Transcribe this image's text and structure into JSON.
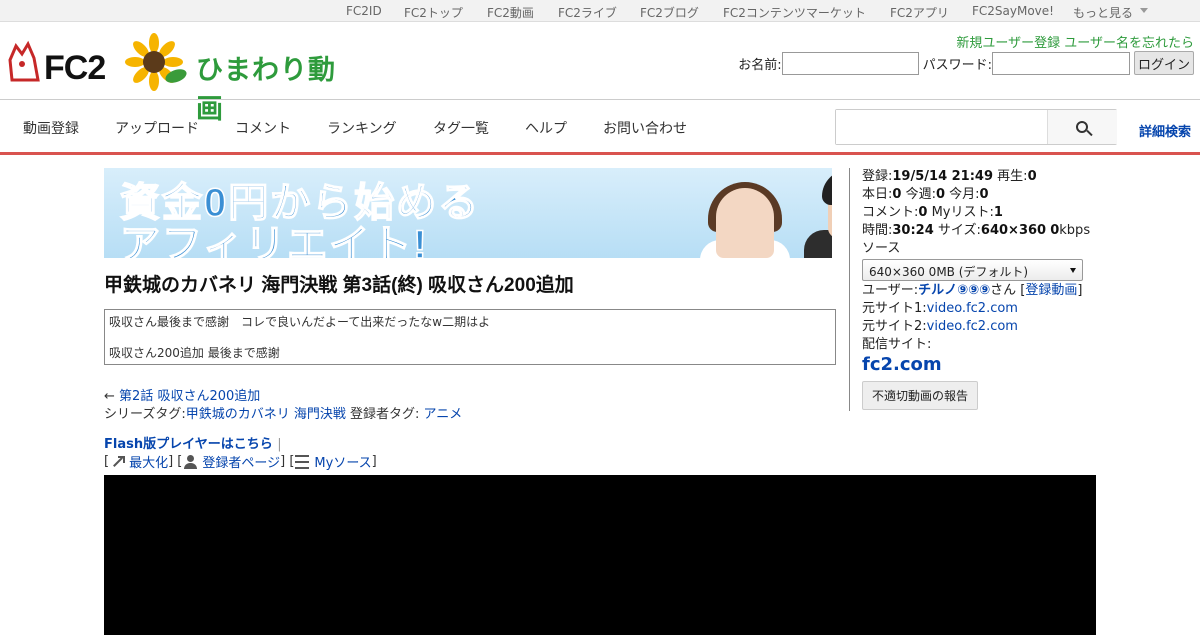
{
  "topbar": {
    "items": [
      "FC2ID",
      "FC2トップ",
      "FC2動画",
      "FC2ライブ",
      "FC2ブログ",
      "FC2コンテンツマーケット",
      "FC2アプリ",
      "FC2SayMove!",
      "もっと見る"
    ]
  },
  "header": {
    "logo_text": "FC2",
    "logo_sub": "ひまわり動画",
    "new_user": "新規ユーザー登録",
    "forgot": "ユーザー名を忘れたら",
    "name_label": "お名前:",
    "password_label": "パスワード:",
    "login_button": "ログイン"
  },
  "nav": {
    "items": [
      "動画登録",
      "アップロード",
      "コメント",
      "ランキング",
      "タグ一覧",
      "ヘルプ",
      "お問い合わせ"
    ],
    "advanced_search": "詳細検索"
  },
  "banner": {
    "line1": "資金0円から始める",
    "line2": "アフィリエイト!"
  },
  "video": {
    "title": "甲鉄城のカバネリ 海門決戦 第3話(終) 吸収さん200追加",
    "description_line1": "吸収さん最後まで感謝　コレで良いんだよーて出来だったなw二期はよ",
    "description_line2": "吸収さん200追加 最後まで感謝",
    "prev_arrow": "←",
    "prev_link": "第2話 吸収さん200追加",
    "series_tag_label": "シリーズタグ:",
    "series_tag": "甲鉄城のカバネリ 海門決戦",
    "user_tag_label": "登録者タグ:",
    "user_tag": "アニメ",
    "flash_link": "Flash版プレイヤーはこちら",
    "maximize": "最大化",
    "uploader_page": "登録者ページ",
    "my_source": "Myソース"
  },
  "info": {
    "registered_label": "登録:",
    "registered": "19/5/14 21:49",
    "plays_label": "再生:",
    "plays": "0",
    "today_label": "本日:",
    "today": "0",
    "week_label": "今週:",
    "week": "0",
    "month_label": "今月:",
    "month": "0",
    "comments_label": "コメント:",
    "comments": "0",
    "mylist_label": "Myリスト:",
    "mylist": "1",
    "duration_label": "時間:",
    "duration": "30:24",
    "size_label": "サイズ:",
    "size": "640×360",
    "kbps_value": "0",
    "kbps_unit": "kbps",
    "source_label": "ソース",
    "source_selected": "640×360 0MB (デフォルト)",
    "user_label": "ユーザー:",
    "user_name": "チルノ⑨⑨⑨",
    "user_suffix": "さん",
    "user_videos": "登録動画",
    "origin1_label": "元サイト1:",
    "origin1": "video.fc2.com",
    "origin2_label": "元サイト2:",
    "origin2": "video.fc2.com",
    "distribution_label": "配信サイト:",
    "distribution": "fc2.com",
    "report_button": "不適切動画の報告"
  },
  "colors": {
    "accent_red": "#d9534f",
    "brand_green": "#2e9b3c",
    "link_blue": "#0645ad"
  }
}
